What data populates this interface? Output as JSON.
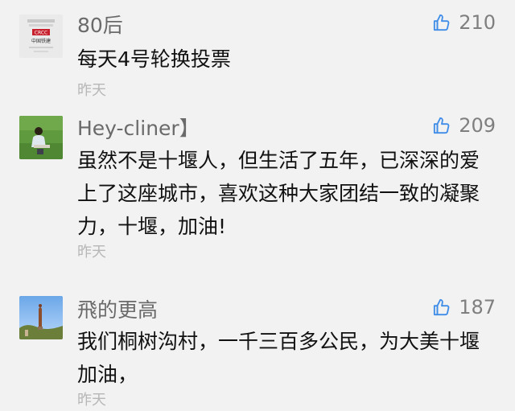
{
  "comments": [
    {
      "author": "80后",
      "likes": "210",
      "text": "每天4号轮换投票",
      "time": "昨天",
      "avatar_text": {
        "line1": "中国铁建",
        "line2": "CRCC"
      }
    },
    {
      "author": "Hey-cliner】",
      "likes": "209",
      "text": "虽然不是十堰人，但生活了五年，已深深的爱上了这座城市，喜欢这种大家团结一致的凝聚力，十堰，加油!",
      "time": "昨天"
    },
    {
      "author": "飛的更高",
      "likes": "187",
      "text": "我们桐树沟村，一千三百多公民，为大美十堰加油，",
      "time": "昨天"
    }
  ],
  "ui": {
    "like_icon": "thumbs-up-icon",
    "colors": {
      "background": "#f2f2f2",
      "author": "#6a6a6a",
      "body_text": "#111111",
      "meta": "#b7b7b7"
    }
  }
}
